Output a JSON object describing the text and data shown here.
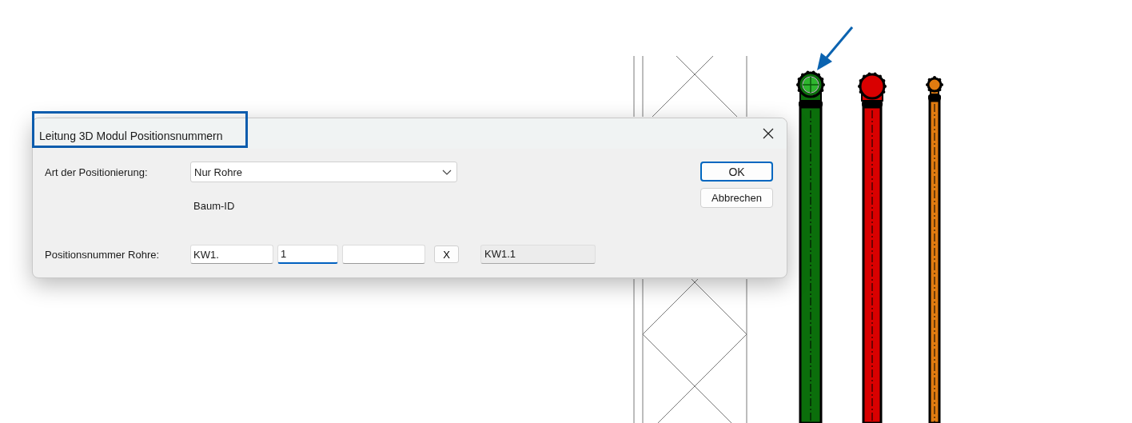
{
  "window": {
    "title": "Leitung 3D Modul Positionsnummern",
    "highlighted": true
  },
  "positioning": {
    "label": "Art der Positionierung:",
    "value": "Nur Rohre"
  },
  "tree_id_label": "Baum-ID",
  "position_number": {
    "label": "Positionsnummer Rohre:",
    "parts": [
      {
        "value": "KW1.",
        "focused": false
      },
      {
        "value": "1",
        "focused": true
      },
      {
        "focused": false
      }
    ],
    "clear_button": "X",
    "result": "KW1.1"
  },
  "buttons": [
    {
      "label": "OK",
      "default": true
    },
    {
      "label": "Abbrechen",
      "default": false
    }
  ],
  "drawing": {
    "pipes": [
      {
        "color": "#0b6e0b",
        "marked": true
      },
      {
        "color": "#d90000",
        "marked": false
      },
      {
        "color": "#e07b10",
        "marked": false
      }
    ]
  }
}
